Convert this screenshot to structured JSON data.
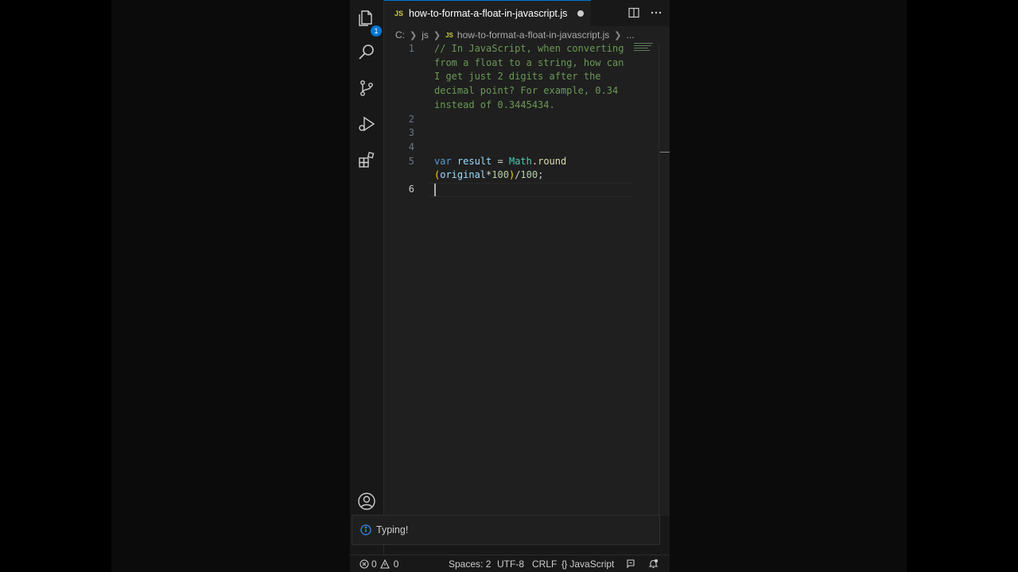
{
  "tab": {
    "language_badge": "JS",
    "filename": "how-to-format-a-float-in-javascript.js"
  },
  "activity_bar": {
    "explorer_badge": "1"
  },
  "breadcrumb": {
    "drive": "C:",
    "folder": "js",
    "file_badge": "JS",
    "file": "how-to-format-a-float-in-javascript.js",
    "more": "..."
  },
  "editor": {
    "lines": [
      {
        "number": "1",
        "text_rows": [
          "// In JavaScript, when converting",
          "from a float to a string, how can",
          "I get just 2 digits after the",
          "decimal point? For example, 0.34",
          "instead of 0.3445434."
        ]
      },
      {
        "number": "2"
      },
      {
        "number": "3"
      },
      {
        "number": "4"
      },
      {
        "number": "5",
        "tokens": {
          "kw": "var",
          "var": "result",
          "eq": " = ",
          "cls": "Math",
          "dot": ".",
          "fn": "round",
          "row2_open": "(",
          "arg": "original",
          "mul": "*",
          "num1": "100",
          "close": ")",
          "div": "/",
          "num2": "100",
          "semi": ";"
        }
      },
      {
        "number": "6"
      }
    ]
  },
  "notification": {
    "message": "Typing!"
  },
  "statusbar": {
    "errors": "0",
    "warnings": "0",
    "indent": "Spaces: 2",
    "encoding": "UTF-8",
    "eol": "CRLF",
    "language_braces": "{ }",
    "language": "JavaScript"
  },
  "colors": {
    "accent": "#0078d4",
    "comment": "#6a9955",
    "keyword": "#569cd6"
  },
  "icons": [
    "files-icon",
    "search-icon",
    "source-control-icon",
    "run-debug-icon",
    "extensions-icon",
    "account-icon",
    "split-editor-icon",
    "more-actions-icon",
    "info-icon",
    "error-icon",
    "warning-icon",
    "copilot-icon",
    "bell-icon"
  ]
}
